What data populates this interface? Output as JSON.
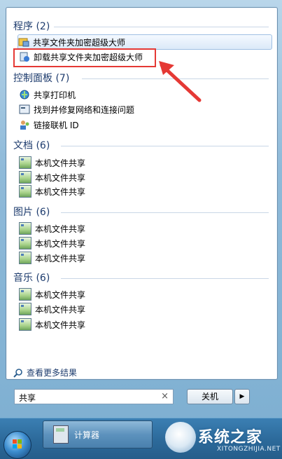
{
  "sections": {
    "programs": {
      "title": "程序 (2)",
      "items": [
        {
          "label": "共享文件夹加密超级大师",
          "icon": "app-lock-icon"
        },
        {
          "label": "卸载共享文件夹加密超级大师",
          "icon": "uninstall-icon"
        }
      ]
    },
    "control_panel": {
      "title": "控制面板 (7)",
      "items": [
        {
          "label": "共享打印机",
          "icon": "network-icon"
        },
        {
          "label": "找到并修复网络和连接问题",
          "icon": "troubleshoot-icon"
        },
        {
          "label": "链接联机 ID",
          "icon": "users-icon"
        }
      ]
    },
    "documents": {
      "title": "文档 (6)",
      "items": [
        {
          "label": "本机文件共享"
        },
        {
          "label": "本机文件共享"
        },
        {
          "label": "本机文件共享"
        }
      ]
    },
    "pictures": {
      "title": "图片 (6)",
      "items": [
        {
          "label": "本机文件共享"
        },
        {
          "label": "本机文件共享"
        },
        {
          "label": "本机文件共享"
        }
      ]
    },
    "music": {
      "title": "音乐 (6)",
      "items": [
        {
          "label": "本机文件共享"
        },
        {
          "label": "本机文件共享"
        },
        {
          "label": "本机文件共享"
        }
      ]
    }
  },
  "see_more": "查看更多结果",
  "search": {
    "value": "共享",
    "clear": "×"
  },
  "shutdown": {
    "label": "关机",
    "arrow": "▶"
  },
  "taskbar": {
    "app_label": "计算器"
  },
  "watermark": {
    "title": "系统之家",
    "subtitle": "XITONGZHIJIA.NET"
  },
  "colors": {
    "annotation": "#e53935",
    "section_title": "#1e3c6e"
  }
}
